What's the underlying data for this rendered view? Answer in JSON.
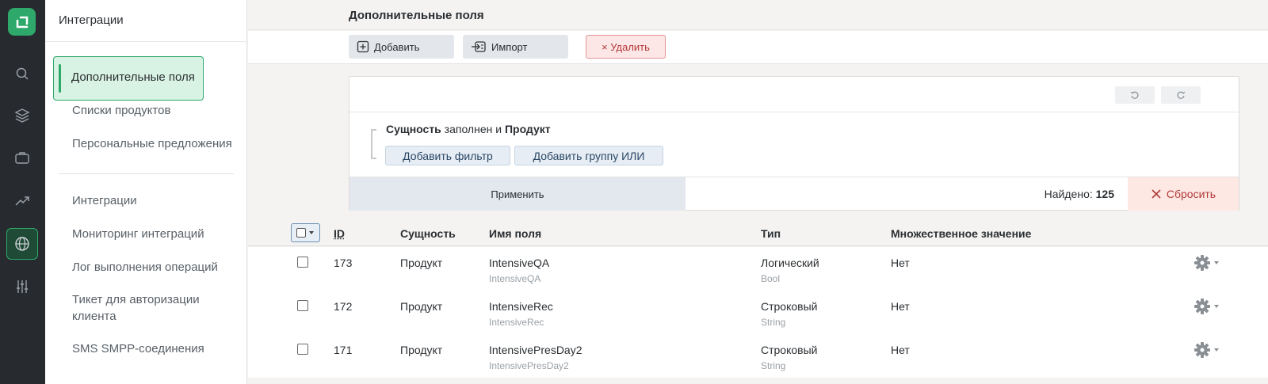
{
  "sidebar": {
    "title": "Интеграции",
    "active_item": "Дополнительные поля",
    "items": [
      "Списки продуктов",
      "Персональные предложения",
      "Интеграции",
      "Мониторинг интеграций",
      "Лог выполнения операций",
      "Тикет для авторизации клиента",
      "SMS SMPP-соединения"
    ]
  },
  "header": {
    "title": "Дополнительные поля"
  },
  "toolbar": {
    "add": "Добавить",
    "import": "Импорт",
    "delete": "× Удалить"
  },
  "filter": {
    "entity_bold": "Сущность",
    "condition": " заполнен и ",
    "product_bold": "Продукт",
    "add_filter": "Добавить фильтр",
    "add_or_group": "Добавить группу ИЛИ",
    "apply": "Применить",
    "found_label": "Найдено: ",
    "found_count": "125",
    "reset": "Сбросить"
  },
  "table": {
    "columns": [
      "ID",
      "Сущность",
      "Имя поля",
      "Тип",
      "Множественное значение"
    ],
    "rows": [
      {
        "id": "173",
        "entity": "Продукт",
        "name": "IntensiveQA",
        "name_sub": "IntensiveQA",
        "type": "Логический",
        "type_sub": "Bool",
        "multiple": "Нет"
      },
      {
        "id": "172",
        "entity": "Продукт",
        "name": "IntensiveRec",
        "name_sub": "IntensiveRec",
        "type": "Строковый",
        "type_sub": "String",
        "multiple": "Нет"
      },
      {
        "id": "171",
        "entity": "Продукт",
        "name": "IntensivePresDay2",
        "name_sub": "IntensivePresDay2",
        "type": "Строковый",
        "type_sub": "String",
        "multiple": "Нет"
      }
    ]
  },
  "icons": {
    "rail": [
      "logo-icon",
      "search-icon",
      "layers-icon",
      "briefcase-icon",
      "trend-icon",
      "globe-icon",
      "sliders-icon"
    ],
    "accent": "#2ea86b"
  }
}
